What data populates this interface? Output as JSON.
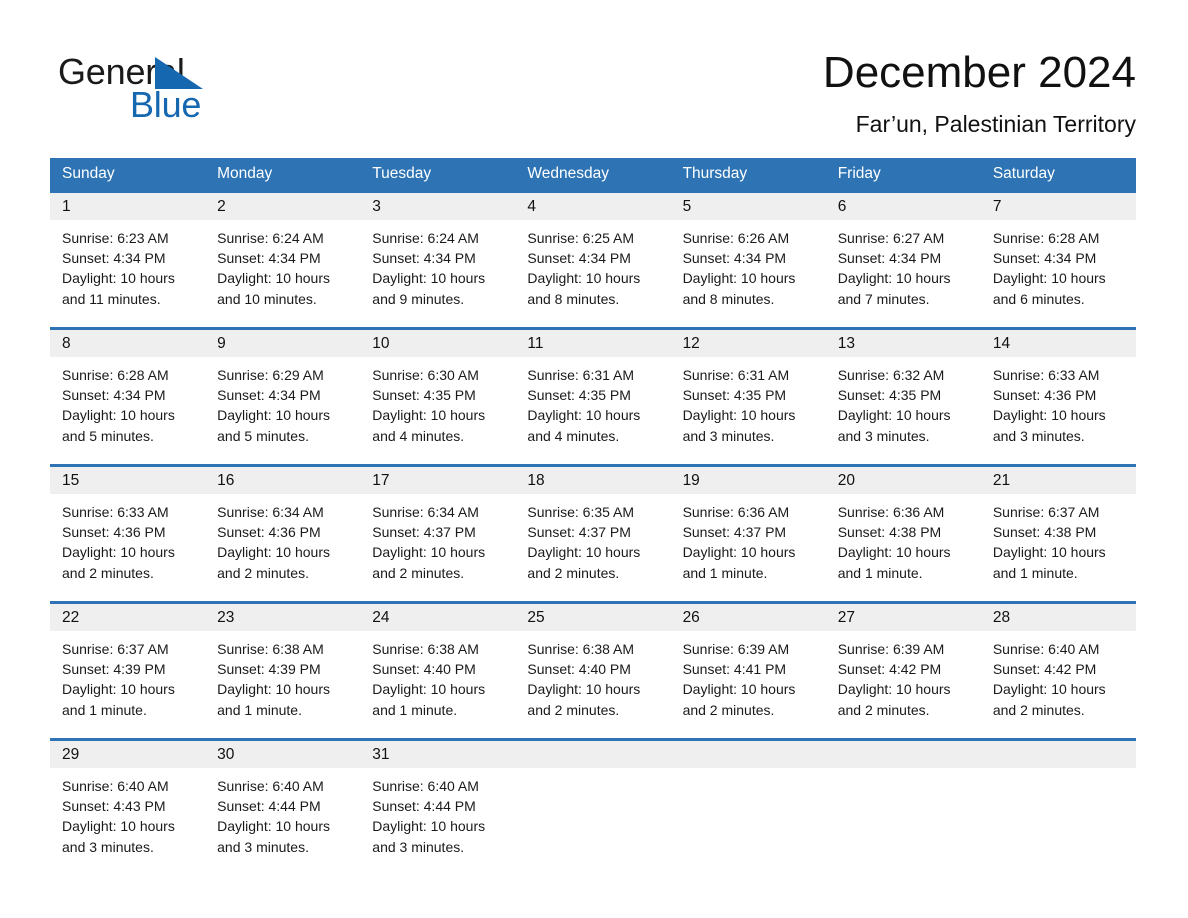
{
  "brand": {
    "name_part1": "General",
    "name_part2": "Blue",
    "accent_color": "#1567b0"
  },
  "header": {
    "month_title": "December 2024",
    "location": "Far’un, Palestinian Territory"
  },
  "theme": {
    "header_blue": "#2e74b5",
    "daynum_band": "#efefef",
    "text": "#1a1a1a"
  },
  "weekdays": [
    "Sunday",
    "Monday",
    "Tuesday",
    "Wednesday",
    "Thursday",
    "Friday",
    "Saturday"
  ],
  "weeks": [
    {
      "days": [
        {
          "num": "1",
          "l1": "Sunrise: 6:23 AM",
          "l2": "Sunset: 4:34 PM",
          "l3": "Daylight: 10 hours",
          "l4": "and 11 minutes."
        },
        {
          "num": "2",
          "l1": "Sunrise: 6:24 AM",
          "l2": "Sunset: 4:34 PM",
          "l3": "Daylight: 10 hours",
          "l4": "and 10 minutes."
        },
        {
          "num": "3",
          "l1": "Sunrise: 6:24 AM",
          "l2": "Sunset: 4:34 PM",
          "l3": "Daylight: 10 hours",
          "l4": "and 9 minutes."
        },
        {
          "num": "4",
          "l1": "Sunrise: 6:25 AM",
          "l2": "Sunset: 4:34 PM",
          "l3": "Daylight: 10 hours",
          "l4": "and 8 minutes."
        },
        {
          "num": "5",
          "l1": "Sunrise: 6:26 AM",
          "l2": "Sunset: 4:34 PM",
          "l3": "Daylight: 10 hours",
          "l4": "and 8 minutes."
        },
        {
          "num": "6",
          "l1": "Sunrise: 6:27 AM",
          "l2": "Sunset: 4:34 PM",
          "l3": "Daylight: 10 hours",
          "l4": "and 7 minutes."
        },
        {
          "num": "7",
          "l1": "Sunrise: 6:28 AM",
          "l2": "Sunset: 4:34 PM",
          "l3": "Daylight: 10 hours",
          "l4": "and 6 minutes."
        }
      ]
    },
    {
      "days": [
        {
          "num": "8",
          "l1": "Sunrise: 6:28 AM",
          "l2": "Sunset: 4:34 PM",
          "l3": "Daylight: 10 hours",
          "l4": "and 5 minutes."
        },
        {
          "num": "9",
          "l1": "Sunrise: 6:29 AM",
          "l2": "Sunset: 4:34 PM",
          "l3": "Daylight: 10 hours",
          "l4": "and 5 minutes."
        },
        {
          "num": "10",
          "l1": "Sunrise: 6:30 AM",
          "l2": "Sunset: 4:35 PM",
          "l3": "Daylight: 10 hours",
          "l4": "and 4 minutes."
        },
        {
          "num": "11",
          "l1": "Sunrise: 6:31 AM",
          "l2": "Sunset: 4:35 PM",
          "l3": "Daylight: 10 hours",
          "l4": "and 4 minutes."
        },
        {
          "num": "12",
          "l1": "Sunrise: 6:31 AM",
          "l2": "Sunset: 4:35 PM",
          "l3": "Daylight: 10 hours",
          "l4": "and 3 minutes."
        },
        {
          "num": "13",
          "l1": "Sunrise: 6:32 AM",
          "l2": "Sunset: 4:35 PM",
          "l3": "Daylight: 10 hours",
          "l4": "and 3 minutes."
        },
        {
          "num": "14",
          "l1": "Sunrise: 6:33 AM",
          "l2": "Sunset: 4:36 PM",
          "l3": "Daylight: 10 hours",
          "l4": "and 3 minutes."
        }
      ]
    },
    {
      "days": [
        {
          "num": "15",
          "l1": "Sunrise: 6:33 AM",
          "l2": "Sunset: 4:36 PM",
          "l3": "Daylight: 10 hours",
          "l4": "and 2 minutes."
        },
        {
          "num": "16",
          "l1": "Sunrise: 6:34 AM",
          "l2": "Sunset: 4:36 PM",
          "l3": "Daylight: 10 hours",
          "l4": "and 2 minutes."
        },
        {
          "num": "17",
          "l1": "Sunrise: 6:34 AM",
          "l2": "Sunset: 4:37 PM",
          "l3": "Daylight: 10 hours",
          "l4": "and 2 minutes."
        },
        {
          "num": "18",
          "l1": "Sunrise: 6:35 AM",
          "l2": "Sunset: 4:37 PM",
          "l3": "Daylight: 10 hours",
          "l4": "and 2 minutes."
        },
        {
          "num": "19",
          "l1": "Sunrise: 6:36 AM",
          "l2": "Sunset: 4:37 PM",
          "l3": "Daylight: 10 hours",
          "l4": "and 1 minute."
        },
        {
          "num": "20",
          "l1": "Sunrise: 6:36 AM",
          "l2": "Sunset: 4:38 PM",
          "l3": "Daylight: 10 hours",
          "l4": "and 1 minute."
        },
        {
          "num": "21",
          "l1": "Sunrise: 6:37 AM",
          "l2": "Sunset: 4:38 PM",
          "l3": "Daylight: 10 hours",
          "l4": "and 1 minute."
        }
      ]
    },
    {
      "days": [
        {
          "num": "22",
          "l1": "Sunrise: 6:37 AM",
          "l2": "Sunset: 4:39 PM",
          "l3": "Daylight: 10 hours",
          "l4": "and 1 minute."
        },
        {
          "num": "23",
          "l1": "Sunrise: 6:38 AM",
          "l2": "Sunset: 4:39 PM",
          "l3": "Daylight: 10 hours",
          "l4": "and 1 minute."
        },
        {
          "num": "24",
          "l1": "Sunrise: 6:38 AM",
          "l2": "Sunset: 4:40 PM",
          "l3": "Daylight: 10 hours",
          "l4": "and 1 minute."
        },
        {
          "num": "25",
          "l1": "Sunrise: 6:38 AM",
          "l2": "Sunset: 4:40 PM",
          "l3": "Daylight: 10 hours",
          "l4": "and 2 minutes."
        },
        {
          "num": "26",
          "l1": "Sunrise: 6:39 AM",
          "l2": "Sunset: 4:41 PM",
          "l3": "Daylight: 10 hours",
          "l4": "and 2 minutes."
        },
        {
          "num": "27",
          "l1": "Sunrise: 6:39 AM",
          "l2": "Sunset: 4:42 PM",
          "l3": "Daylight: 10 hours",
          "l4": "and 2 minutes."
        },
        {
          "num": "28",
          "l1": "Sunrise: 6:40 AM",
          "l2": "Sunset: 4:42 PM",
          "l3": "Daylight: 10 hours",
          "l4": "and 2 minutes."
        }
      ]
    },
    {
      "days": [
        {
          "num": "29",
          "l1": "Sunrise: 6:40 AM",
          "l2": "Sunset: 4:43 PM",
          "l3": "Daylight: 10 hours",
          "l4": "and 3 minutes."
        },
        {
          "num": "30",
          "l1": "Sunrise: 6:40 AM",
          "l2": "Sunset: 4:44 PM",
          "l3": "Daylight: 10 hours",
          "l4": "and 3 minutes."
        },
        {
          "num": "31",
          "l1": "Sunrise: 6:40 AM",
          "l2": "Sunset: 4:44 PM",
          "l3": "Daylight: 10 hours",
          "l4": "and 3 minutes."
        },
        {
          "num": "",
          "l1": "",
          "l2": "",
          "l3": "",
          "l4": ""
        },
        {
          "num": "",
          "l1": "",
          "l2": "",
          "l3": "",
          "l4": ""
        },
        {
          "num": "",
          "l1": "",
          "l2": "",
          "l3": "",
          "l4": ""
        },
        {
          "num": "",
          "l1": "",
          "l2": "",
          "l3": "",
          "l4": ""
        }
      ]
    }
  ]
}
